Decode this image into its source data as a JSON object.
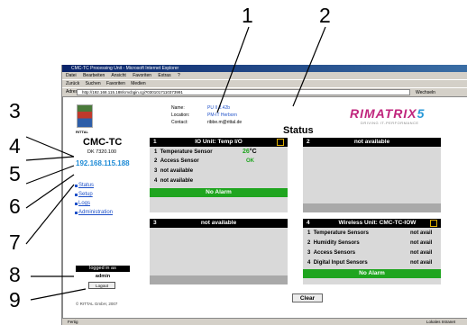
{
  "callouts": [
    "1",
    "2",
    "3",
    "4",
    "5",
    "6",
    "7",
    "8",
    "9"
  ],
  "browser": {
    "title": "CMC-TC Processing Unit - Microsoft Internet Explorer",
    "menu": [
      "Datei",
      "Bearbeiten",
      "Ansicht",
      "Favoriten",
      "Extras",
      "?"
    ],
    "toolbar": [
      "Zurück",
      "Suchen",
      "Favoriten",
      "Medien"
    ],
    "address_label": "Adresse",
    "address": "http://192.168.115.188/cmcbgin.cgi?0301017110373991",
    "go_label": "Wechseln",
    "status_left": "Fertig",
    "status_right": "Lokales Intranet"
  },
  "left": {
    "logo_text": "RITTAL",
    "unit_name": "CMC-TC",
    "unit_model": "DK 7320.100",
    "ip": "192.168.115.188",
    "nav": [
      "Status",
      "Setup",
      "Logs",
      "Administration"
    ],
    "logged_in_as": "logged in as",
    "user": "admin",
    "logout": "Logout",
    "copyright": "© RITTAL GmbH, 2007"
  },
  "header": {
    "name_label": "Name:",
    "name_value": "PU II 2.42b",
    "location_label": "Location:",
    "location_value": "PM-IT Herborn",
    "contact_label": "Contact:",
    "contact_value": "ribbe.m@rittal.de",
    "brand": "RIMATRIX",
    "brand_suffix": "5",
    "brand_sub": "DRIVING IT-PERFORMANCE",
    "status_title": "Status"
  },
  "panels": {
    "p1": {
      "num": "1",
      "title": "IO Unit: Temp I/O",
      "rows": [
        {
          "num": "1",
          "label": "Temperature Sensor",
          "value": "26",
          "unit": "°C"
        },
        {
          "num": "2",
          "label": "Access Sensor",
          "value": "OK"
        },
        {
          "num": "3",
          "label": "not available"
        },
        {
          "num": "4",
          "label": "not available"
        }
      ],
      "alarm": "No Alarm"
    },
    "p2": {
      "num": "2",
      "title": "not available"
    },
    "p3": {
      "num": "3",
      "title": "not available"
    },
    "p4": {
      "num": "4",
      "title": "Wireless Unit: CMC-TC-IOW",
      "rows": [
        {
          "num": "1",
          "label": "Temperature Sensors",
          "value": "not avail"
        },
        {
          "num": "2",
          "label": "Humidity Sensors",
          "value": "not avail"
        },
        {
          "num": "3",
          "label": "Access Sensors",
          "value": "not avail"
        },
        {
          "num": "4",
          "label": "Digital Input Sensors",
          "value": "not avail"
        }
      ],
      "alarm": "No Alarm"
    },
    "clear": "Clear"
  },
  "colors": {
    "ok_green": "#1fa51f",
    "ip_blue": "#1e8bd6",
    "brand_magenta": "#c0267d"
  }
}
